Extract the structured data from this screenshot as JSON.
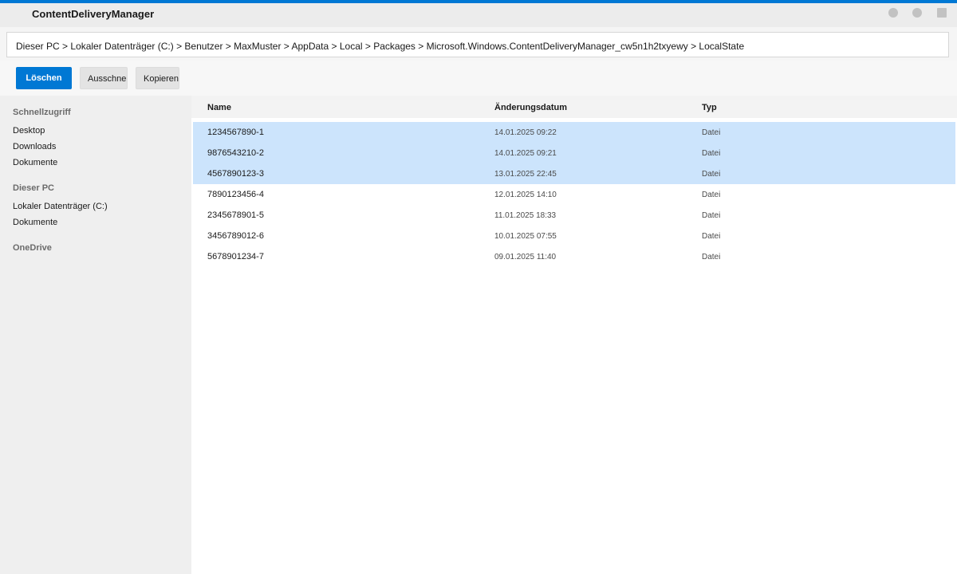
{
  "window": {
    "title": "ContentDeliveryManager",
    "accent_color": "#0078d4",
    "controls": [
      "minimize-icon",
      "maximize-icon",
      "close-icon"
    ]
  },
  "address": {
    "path": "Dieser PC > Lokaler Datenträger (C:) > Benutzer > MaxMuster > AppData > Local > Packages > Microsoft.Windows.ContentDeliveryManager_cw5n1h2txyewy > LocalState"
  },
  "toolbar": {
    "delete_label": "Löschen",
    "cut_label": "Ausschneiden",
    "copy_label": "Kopieren"
  },
  "sidebar": {
    "quick_access": {
      "label": "Schnellzugriff",
      "items": [
        "Desktop",
        "Downloads",
        "Dokumente"
      ]
    },
    "this_pc": {
      "label": "Dieser PC",
      "items": [
        "Lokaler Datenträger (C:)",
        "Dokumente"
      ]
    },
    "onedrive": {
      "label": "OneDrive"
    }
  },
  "files": {
    "columns": [
      "Name",
      "Änderungsdatum",
      "Typ"
    ],
    "selection_color": "#cce4fc",
    "rows": [
      {
        "name": "1234567890-1",
        "date": "14.01.2025 09:22",
        "type": "Datei",
        "selected": true
      },
      {
        "name": "9876543210-2",
        "date": "14.01.2025 09:21",
        "type": "Datei",
        "selected": true
      },
      {
        "name": "4567890123-3",
        "date": "13.01.2025 22:45",
        "type": "Datei",
        "selected": true
      },
      {
        "name": "7890123456-4",
        "date": "12.01.2025 14:10",
        "type": "Datei",
        "selected": false
      },
      {
        "name": "2345678901-5",
        "date": "11.01.2025 18:33",
        "type": "Datei",
        "selected": false
      },
      {
        "name": "3456789012-6",
        "date": "10.01.2025 07:55",
        "type": "Datei",
        "selected": false
      },
      {
        "name": "5678901234-7",
        "date": "09.01.2025 11:40",
        "type": "Datei",
        "selected": false
      }
    ]
  }
}
